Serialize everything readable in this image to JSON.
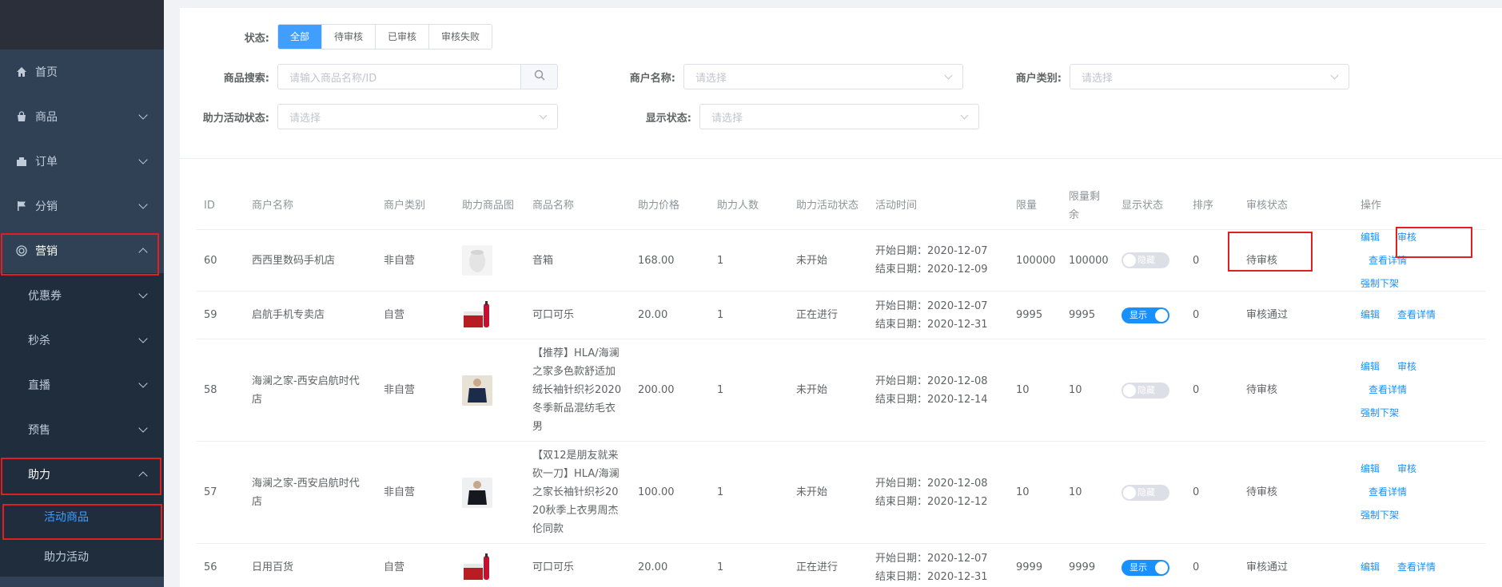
{
  "sidebar": {
    "items": [
      {
        "label": "首页",
        "icon": "home-icon"
      },
      {
        "label": "商品",
        "icon": "bag-icon"
      },
      {
        "label": "订单",
        "icon": "order-icon"
      },
      {
        "label": "分销",
        "icon": "flag-icon"
      },
      {
        "label": "营销",
        "icon": "marketing-icon"
      }
    ],
    "marketing_children": [
      "优惠券",
      "秒杀",
      "直播",
      "预售",
      "助力"
    ],
    "assist_children": [
      "活动商品",
      "助力活动"
    ]
  },
  "filters": {
    "status_label": "状态:",
    "status_options": [
      "全部",
      "待审核",
      "已审核",
      "审核失败"
    ],
    "status_selected": "全部",
    "product_search_label": "商品搜索:",
    "product_search_placeholder": "请输入商品名称/ID",
    "merchant_name_label": "商户名称:",
    "merchant_type_label": "商户类别:",
    "activity_status_label": "助力活动状态:",
    "display_status_label": "显示状态:",
    "select_placeholder": "请选择"
  },
  "table": {
    "headers": [
      "ID",
      "商户名称",
      "商户类别",
      "助力商品图",
      "商品名称",
      "助力价格",
      "助力人数",
      "助力活动状态",
      "活动时间",
      "限量",
      "限量剩余",
      "显示状态",
      "排序",
      "审核状态",
      "操作"
    ],
    "rows": [
      {
        "id": "60",
        "merchant": "西西里数码手机店",
        "type": "非自营",
        "name": "音箱",
        "price": "168.00",
        "people": "1",
        "activity_status": "未开始",
        "start": "开始日期：2020-12-07",
        "end": "结束日期：2020-12-09",
        "limit": "100000",
        "remain": "100000",
        "display": "隐藏",
        "display_on": false,
        "sort": "0",
        "audit": "待审核",
        "ops": [
          "编辑",
          "审核",
          "查看详情",
          "强制下架"
        ],
        "thumb": "speaker"
      },
      {
        "id": "59",
        "merchant": "启航手机专卖店",
        "type": "自营",
        "name": "可口可乐",
        "price": "20.00",
        "people": "1",
        "activity_status": "正在进行",
        "start": "开始日期：2020-12-07",
        "end": "结束日期：2020-12-31",
        "limit": "9995",
        "remain": "9995",
        "display": "显示",
        "display_on": true,
        "sort": "0",
        "audit": "审核通过",
        "ops": [
          "编辑",
          "查看详情"
        ],
        "thumb": "cola"
      },
      {
        "id": "58",
        "merchant": "海澜之家-西安启航时代店",
        "type": "非自营",
        "name": "【推荐】HLA/海澜之家多色款舒适加绒长袖针织衫2020冬季新品混纺毛衣男",
        "price": "200.00",
        "people": "1",
        "activity_status": "未开始",
        "start": "开始日期：2020-12-08",
        "end": "结束日期：2020-12-14",
        "limit": "10",
        "remain": "10",
        "display": "隐藏",
        "display_on": false,
        "sort": "0",
        "audit": "待审核",
        "ops": [
          "编辑",
          "审核",
          "查看详情",
          "强制下架"
        ],
        "thumb": "sweater"
      },
      {
        "id": "57",
        "merchant": "海澜之家-西安启航时代店",
        "type": "非自营",
        "name": "【双12是朋友就来砍一刀】HLA/海澜之家长袖针织衫2020秋季上衣男周杰伦同款",
        "price": "100.00",
        "people": "1",
        "activity_status": "未开始",
        "start": "开始日期：2020-12-08",
        "end": "结束日期：2020-12-12",
        "limit": "10",
        "remain": "10",
        "display": "隐藏",
        "display_on": false,
        "sort": "0",
        "audit": "待审核",
        "ops": [
          "编辑",
          "审核",
          "查看详情",
          "强制下架"
        ],
        "thumb": "sweater-dark"
      },
      {
        "id": "56",
        "merchant": "日用百货",
        "type": "自营",
        "name": "可口可乐",
        "price": "20.00",
        "people": "1",
        "activity_status": "正在进行",
        "start": "开始日期：2020-12-07",
        "end": "结束日期：2020-12-31",
        "limit": "9999",
        "remain": "9999",
        "display": "显示",
        "display_on": true,
        "sort": "0",
        "audit": "审核通过",
        "ops": [
          "编辑",
          "查看详情"
        ],
        "thumb": "cola"
      }
    ]
  },
  "colors": {
    "sidebar": "#304156",
    "accent": "#409eff",
    "highlight": "#e02020"
  }
}
